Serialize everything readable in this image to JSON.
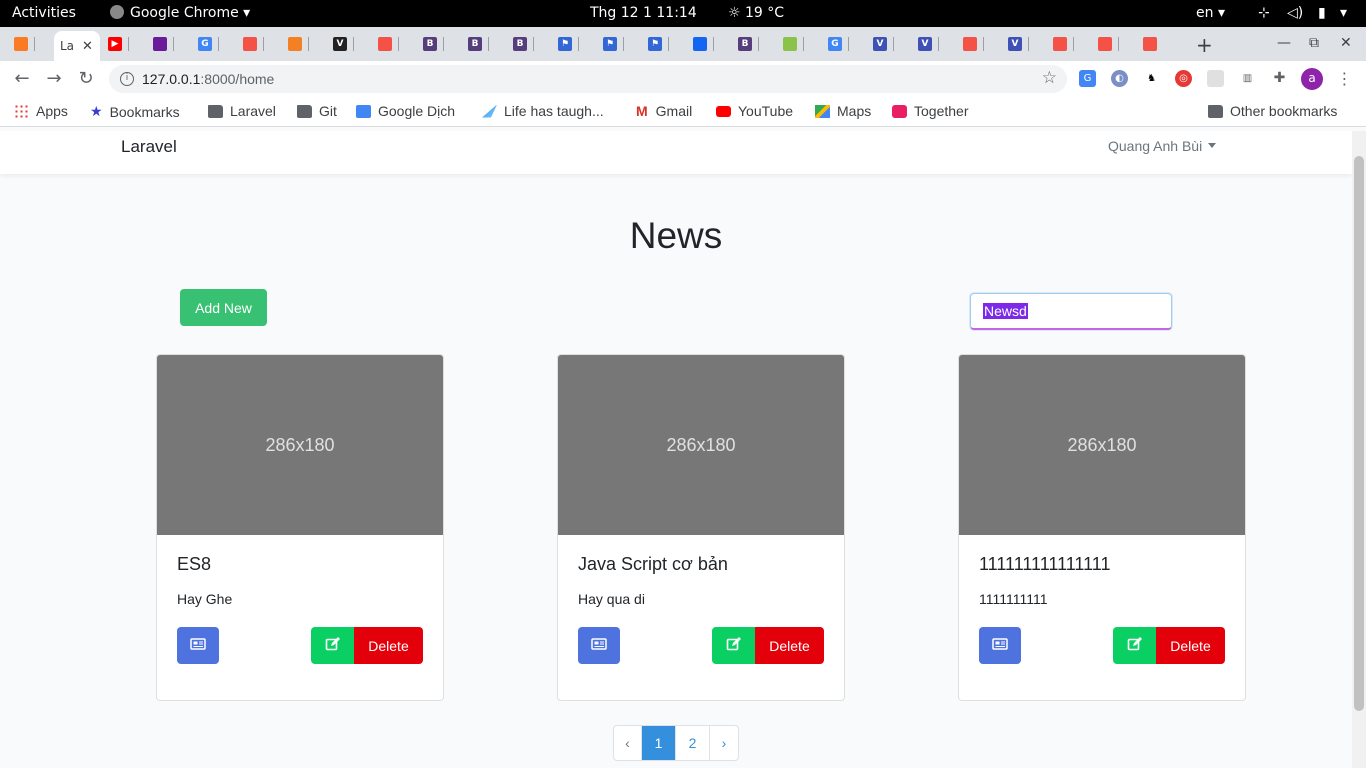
{
  "system": {
    "activities": "Activities",
    "app_name": "Google Chrome",
    "clock": "Thg 12 1  11:14",
    "weather": "19 °C",
    "language": "en"
  },
  "browser": {
    "url_host": "127.0.0.1",
    "url_path": ":8000/home",
    "profile_initial": "a",
    "active_tab_label": "La",
    "bookmarks": [
      {
        "label": "Apps"
      },
      {
        "label": "Bookmarks"
      },
      {
        "label": "Laravel"
      },
      {
        "label": "Git"
      },
      {
        "label": "Google Dịch"
      },
      {
        "label": "Life has taugh..."
      },
      {
        "label": "Gmail"
      },
      {
        "label": "YouTube"
      },
      {
        "label": "Maps"
      },
      {
        "label": "Together"
      },
      {
        "label": "Other bookmarks"
      }
    ]
  },
  "page": {
    "brand": "Laravel",
    "user_name": "Quang Anh Bùi",
    "heading": "News",
    "add_button": "Add New",
    "search_value": "Newsd",
    "cards": [
      {
        "image_label": "286x180",
        "title": "ES8",
        "text": "Hay Ghe",
        "delete_label": "Delete"
      },
      {
        "image_label": "286x180",
        "title": "Java Script cơ bản",
        "text": "Hay qua di",
        "delete_label": "Delete"
      },
      {
        "image_label": "286x180",
        "title": "111111111111111",
        "text": "1111111111",
        "delete_label": "Delete"
      }
    ],
    "pagination": {
      "prev": "‹",
      "pages": [
        "1",
        "2"
      ],
      "current_page": "1",
      "next": "›"
    }
  },
  "colors": {
    "success": "#38c172",
    "primary": "#4e73df",
    "danger": "#e3000b",
    "link": "#3490dc"
  }
}
